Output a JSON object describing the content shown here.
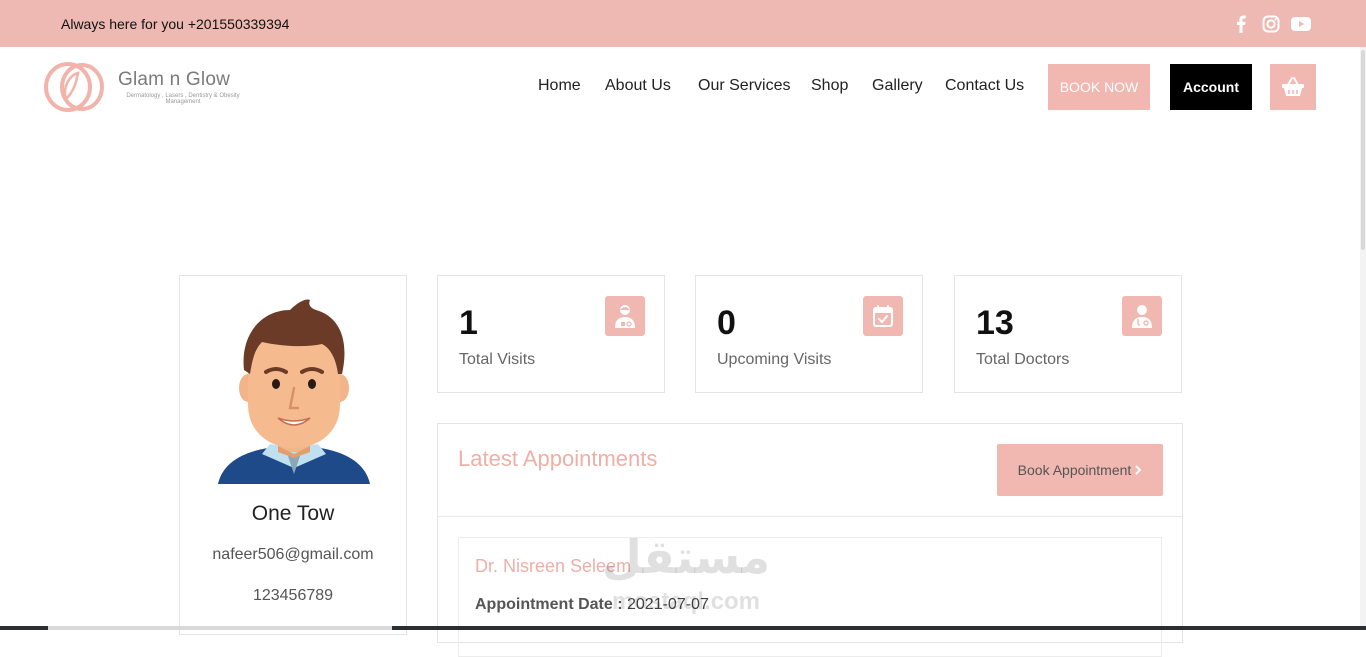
{
  "topbar": {
    "contact_text": "Always here for you +201550339394",
    "social": [
      "facebook-icon",
      "instagram-icon",
      "youtube-icon"
    ]
  },
  "brand": {
    "name": "Glam n Glow",
    "tagline": "Dermatology , Lasers , Dentistry & Obesity Management",
    "accent_color": "#f0b8b1"
  },
  "nav": {
    "items": [
      {
        "label": "Home"
      },
      {
        "label": "About Us"
      },
      {
        "label": "Our Services"
      },
      {
        "label": "Shop"
      },
      {
        "label": "Gallery"
      },
      {
        "label": "Contact Us"
      }
    ],
    "book_now": "BOOK NOW",
    "account": "Account",
    "cart_icon": "basket-icon"
  },
  "profile": {
    "name": "One Tow",
    "email": "nafeer506@gmail.com",
    "phone": "123456789",
    "avatar_icon": "user-avatar"
  },
  "stats": [
    {
      "value": "1",
      "label": "Total Visits",
      "icon": "patient-icon"
    },
    {
      "value": "0",
      "label": "Upcoming Visits",
      "icon": "calendar-check-icon"
    },
    {
      "value": "13",
      "label": "Total Doctors",
      "icon": "doctor-icon"
    }
  ],
  "appointments": {
    "title": "Latest Appointments",
    "book_button": "Book Appointment",
    "items": [
      {
        "doctor": "Dr. Nisreen Seleem",
        "date_label": "Appointment Date :",
        "date": "2021-07-07"
      }
    ]
  },
  "watermark": {
    "arabic": "مستقل",
    "latin": "mostaql.com"
  }
}
